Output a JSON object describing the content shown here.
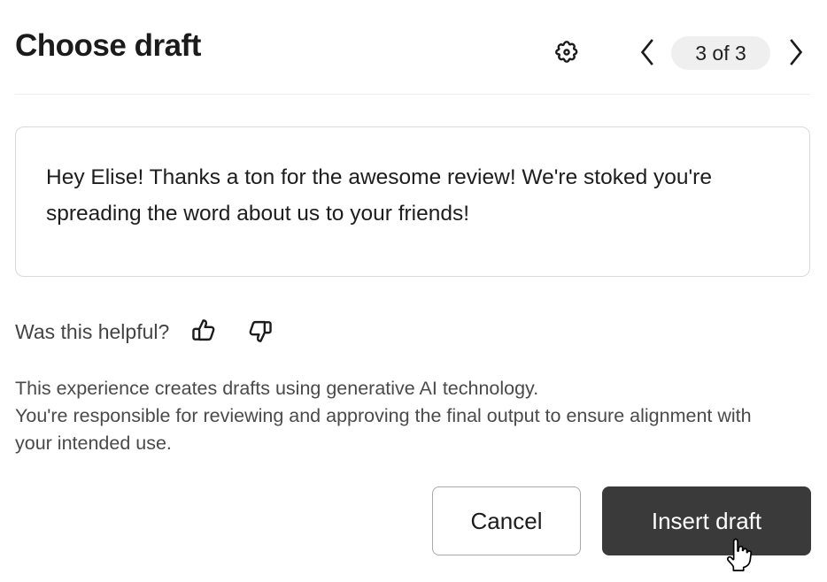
{
  "header": {
    "title": "Choose draft",
    "settings_icon": "gear-icon",
    "prev_icon": "chevron-left-icon",
    "next_icon": "chevron-right-icon",
    "pagination_label": "3 of 3"
  },
  "draft": {
    "text": "Hey Elise! Thanks a ton for the awesome review! We're stoked you're spreading the word about us to your friends!"
  },
  "feedback": {
    "label": "Was this helpful?",
    "thumbs_up_icon": "thumbs-up-icon",
    "thumbs_down_icon": "thumbs-down-icon"
  },
  "disclaimer": {
    "line1": "This experience creates drafts using generative AI technology.",
    "line2": "You're responsible for reviewing and approving the final output to ensure alignment with your intended use."
  },
  "footer": {
    "cancel_label": "Cancel",
    "insert_label": "Insert draft"
  },
  "cursor": {
    "type": "pointing-hand-cursor"
  },
  "colors": {
    "primary_button_bg": "#3a3a3a",
    "pill_bg": "#efefef",
    "card_border": "#d9d9d9",
    "divider": "#ededed",
    "text_primary": "#1d1d1d",
    "text_secondary": "#4a4a4a"
  }
}
